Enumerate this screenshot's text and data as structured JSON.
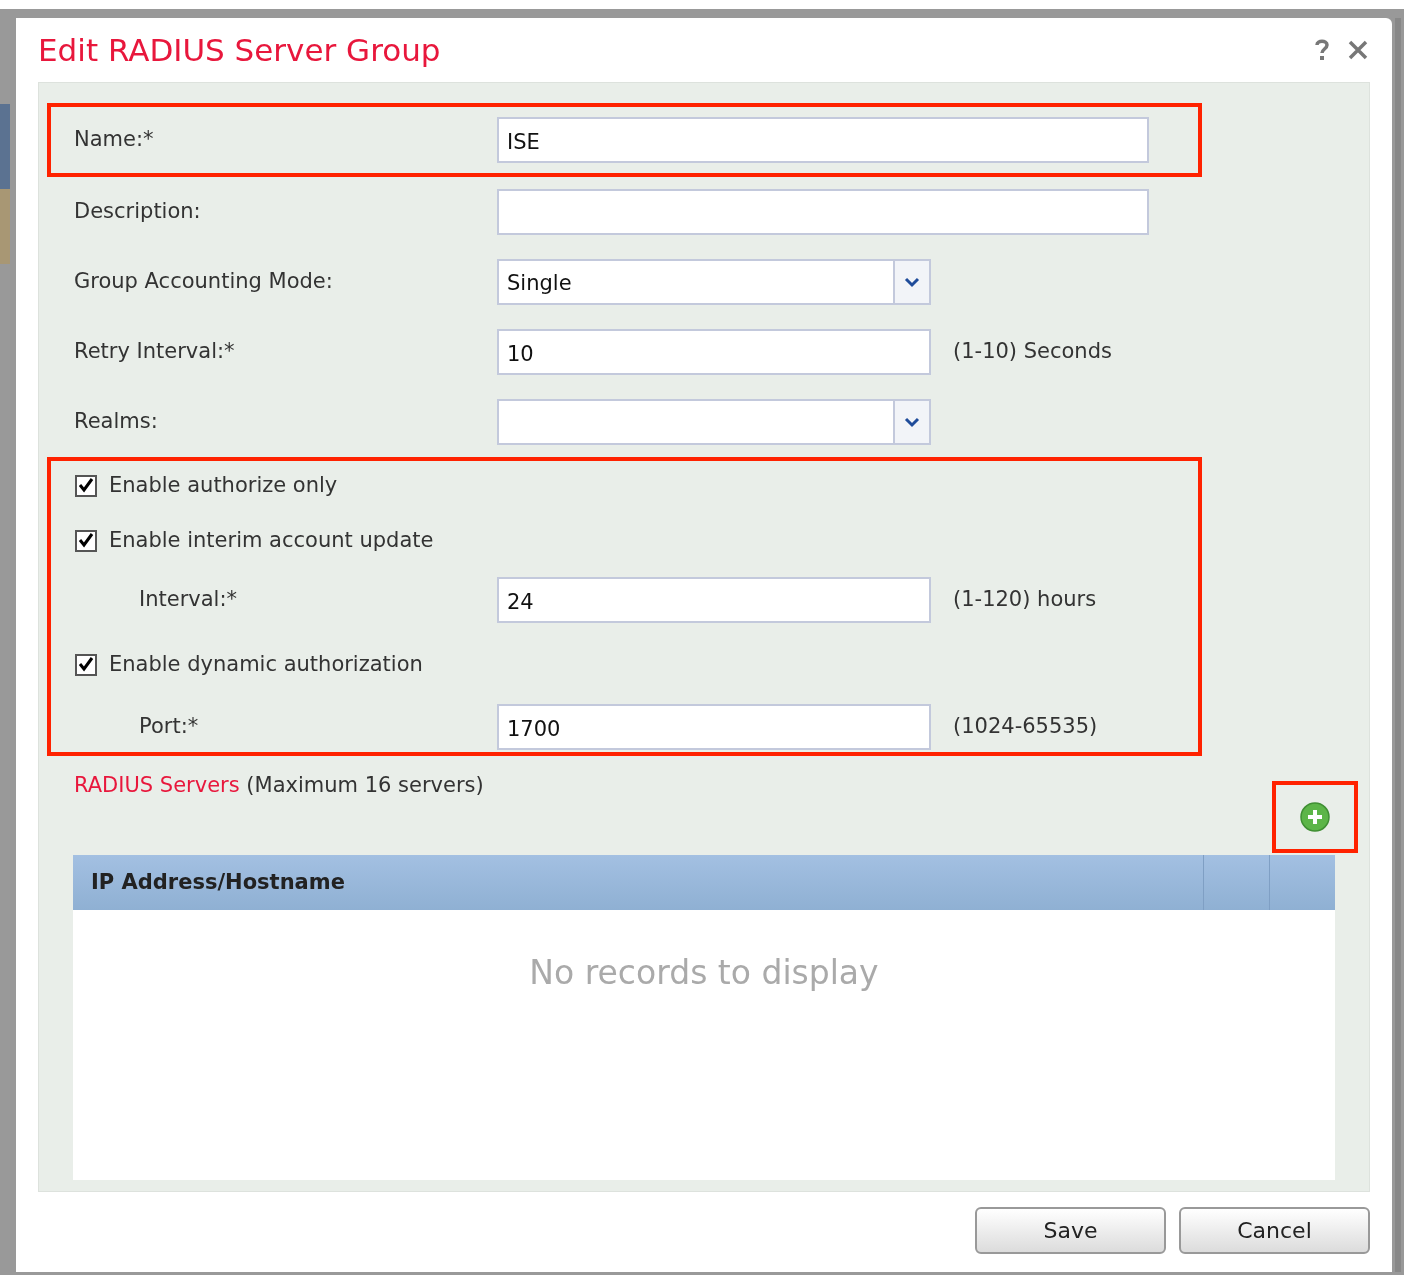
{
  "dialog": {
    "title": "Edit RADIUS Server Group"
  },
  "fields": [
    {
      "kind": "wide",
      "label": "Name:*",
      "value": "ISE"
    },
    {
      "kind": "wide",
      "label": "Description:"
    },
    {
      "kind": "select",
      "label": "Group Accounting Mode:",
      "value": "Single"
    },
    {
      "kind": "short",
      "label": "Retry Interval:*",
      "value": "10",
      "hint": "(1-10) Seconds"
    },
    {
      "kind": "select",
      "label": "Realms:"
    }
  ],
  "options": [
    {
      "label": "Enable authorize only",
      "checked": true
    },
    {
      "label": "Enable interim account update",
      "checked": true,
      "children": [
        {
          "label": "Interval:*",
          "value": "24",
          "hint": "(1-120) hours"
        }
      ]
    },
    {
      "label": "Enable dynamic authorization",
      "checked": true,
      "children": [
        {
          "label": "Port:*",
          "value": "1700",
          "hint": "(1024-65535)"
        }
      ]
    }
  ],
  "servers": {
    "title": "RADIUS Servers",
    "note": "(Maximum 16 servers)",
    "columns": [
      "IP Address/Hostname"
    ],
    "empty": "No records to display"
  },
  "buttons": [
    "Save",
    "Cancel"
  ]
}
